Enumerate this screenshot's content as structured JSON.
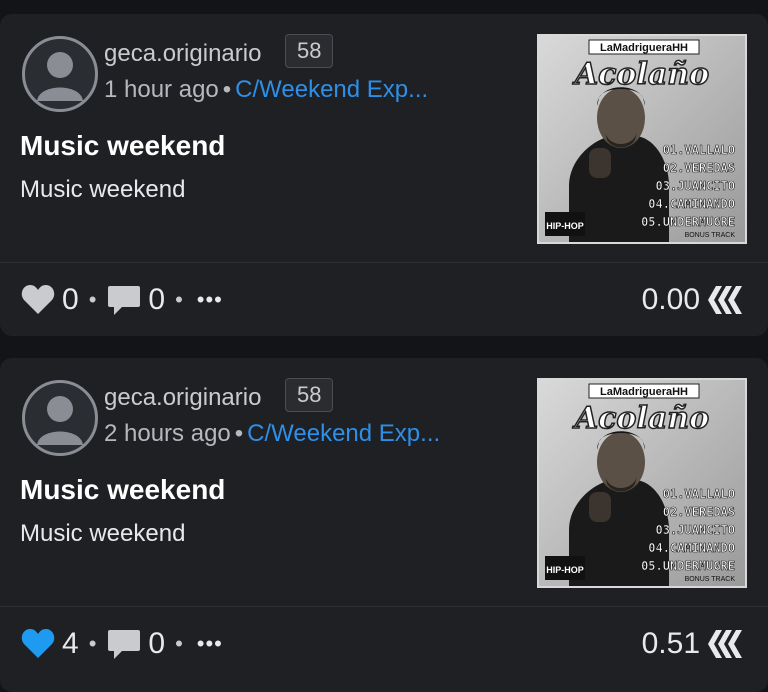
{
  "posts": [
    {
      "author": "geca.originario",
      "reputation": "58",
      "time": "1 hour ago",
      "community": "C/Weekend Exp...",
      "title": "Music weekend",
      "body": "Music weekend",
      "likes": "0",
      "liked": false,
      "comments": "0",
      "payout": "0.00",
      "thumbnail": {
        "header": "LaMadrigueraHH",
        "title": "Acolaño",
        "tracks": [
          "01.VALLALO",
          "02.VEREDAS",
          "03.JUANCITO",
          "04.CAMINANDO",
          "05.UNDERMUGRE"
        ],
        "bonus": "BONUS TRACK",
        "badge": "HIP-HOP"
      }
    },
    {
      "author": "geca.originario",
      "reputation": "58",
      "time": "2 hours ago",
      "community": "C/Weekend Exp...",
      "title": "Music weekend",
      "body": "Music weekend",
      "likes": "4",
      "liked": true,
      "comments": "0",
      "payout": "0.51",
      "thumbnail": {
        "header": "LaMadrigueraHH",
        "title": "Acolaño",
        "tracks": [
          "01.VALLALO",
          "02.VEREDAS",
          "03.JUANCITO",
          "04.CAMINANDO",
          "05.UNDERMUGRE"
        ],
        "bonus": "BONUS TRACK",
        "badge": "HIP-HOP"
      }
    }
  ],
  "ui": {
    "separator": "•",
    "more": "•••"
  },
  "colors": {
    "background": "#121417",
    "card": "#1e2024",
    "link": "#2e8fe8",
    "liked": "#1e9bf0",
    "icon": "#c9cbcf"
  },
  "icons": {
    "like": "heart-icon",
    "comment": "comment-icon",
    "more": "more-icon",
    "currency": "hive-icon"
  }
}
